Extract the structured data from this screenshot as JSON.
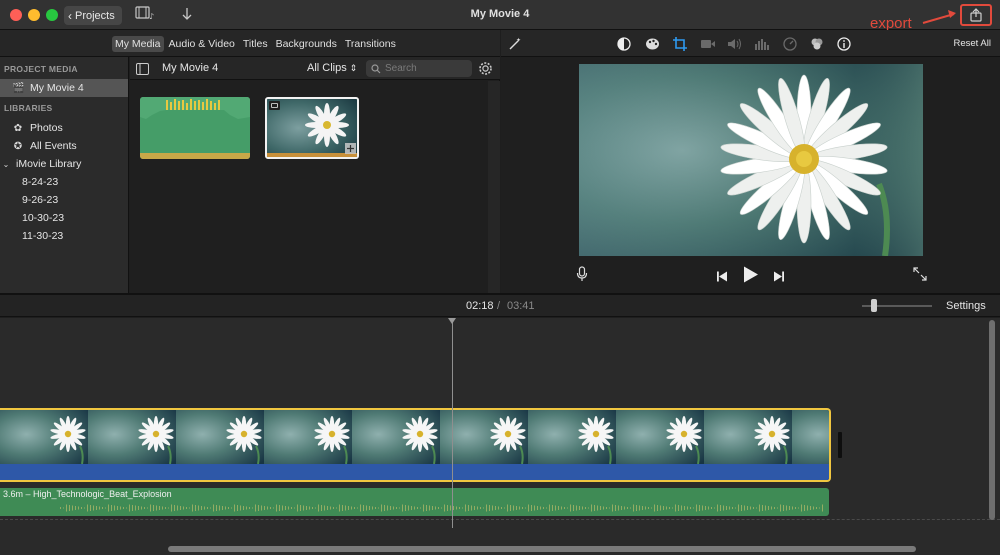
{
  "window": {
    "title": "My Movie 4",
    "projects_label": "Projects"
  },
  "annotation": {
    "text": "export",
    "color": "#e24a3c"
  },
  "tabs": [
    {
      "label": "My Media",
      "active": true
    },
    {
      "label": "Audio & Video"
    },
    {
      "label": "Titles"
    },
    {
      "label": "Backgrounds"
    },
    {
      "label": "Transitions"
    }
  ],
  "viewer_toolbar": {
    "reset_label": "Reset All"
  },
  "sidebar": {
    "project_media_header": "PROJECT MEDIA",
    "project_item": "My Movie 4",
    "libraries_header": "LIBRARIES",
    "items": [
      {
        "label": "Photos"
      },
      {
        "label": "All Events"
      },
      {
        "label": "iMovie Library"
      },
      {
        "label": "8-24-23"
      },
      {
        "label": "9-26-23"
      },
      {
        "label": "10-30-23"
      },
      {
        "label": "11-30-23"
      }
    ]
  },
  "browser": {
    "title": "My Movie 4",
    "filter": "All Clips",
    "search_placeholder": "Search"
  },
  "timeline": {
    "current_time": "02:18",
    "separator": "/",
    "total_time": "03:41",
    "settings_label": "Settings",
    "music_label": "3.6m – High_Technologic_Beat_Explosion"
  },
  "colors": {
    "accent_yellow": "#f0c640",
    "audio_green": "#3f8b55",
    "clip_audio_blue": "#2e58a8",
    "export_highlight": "#e24a3c"
  }
}
